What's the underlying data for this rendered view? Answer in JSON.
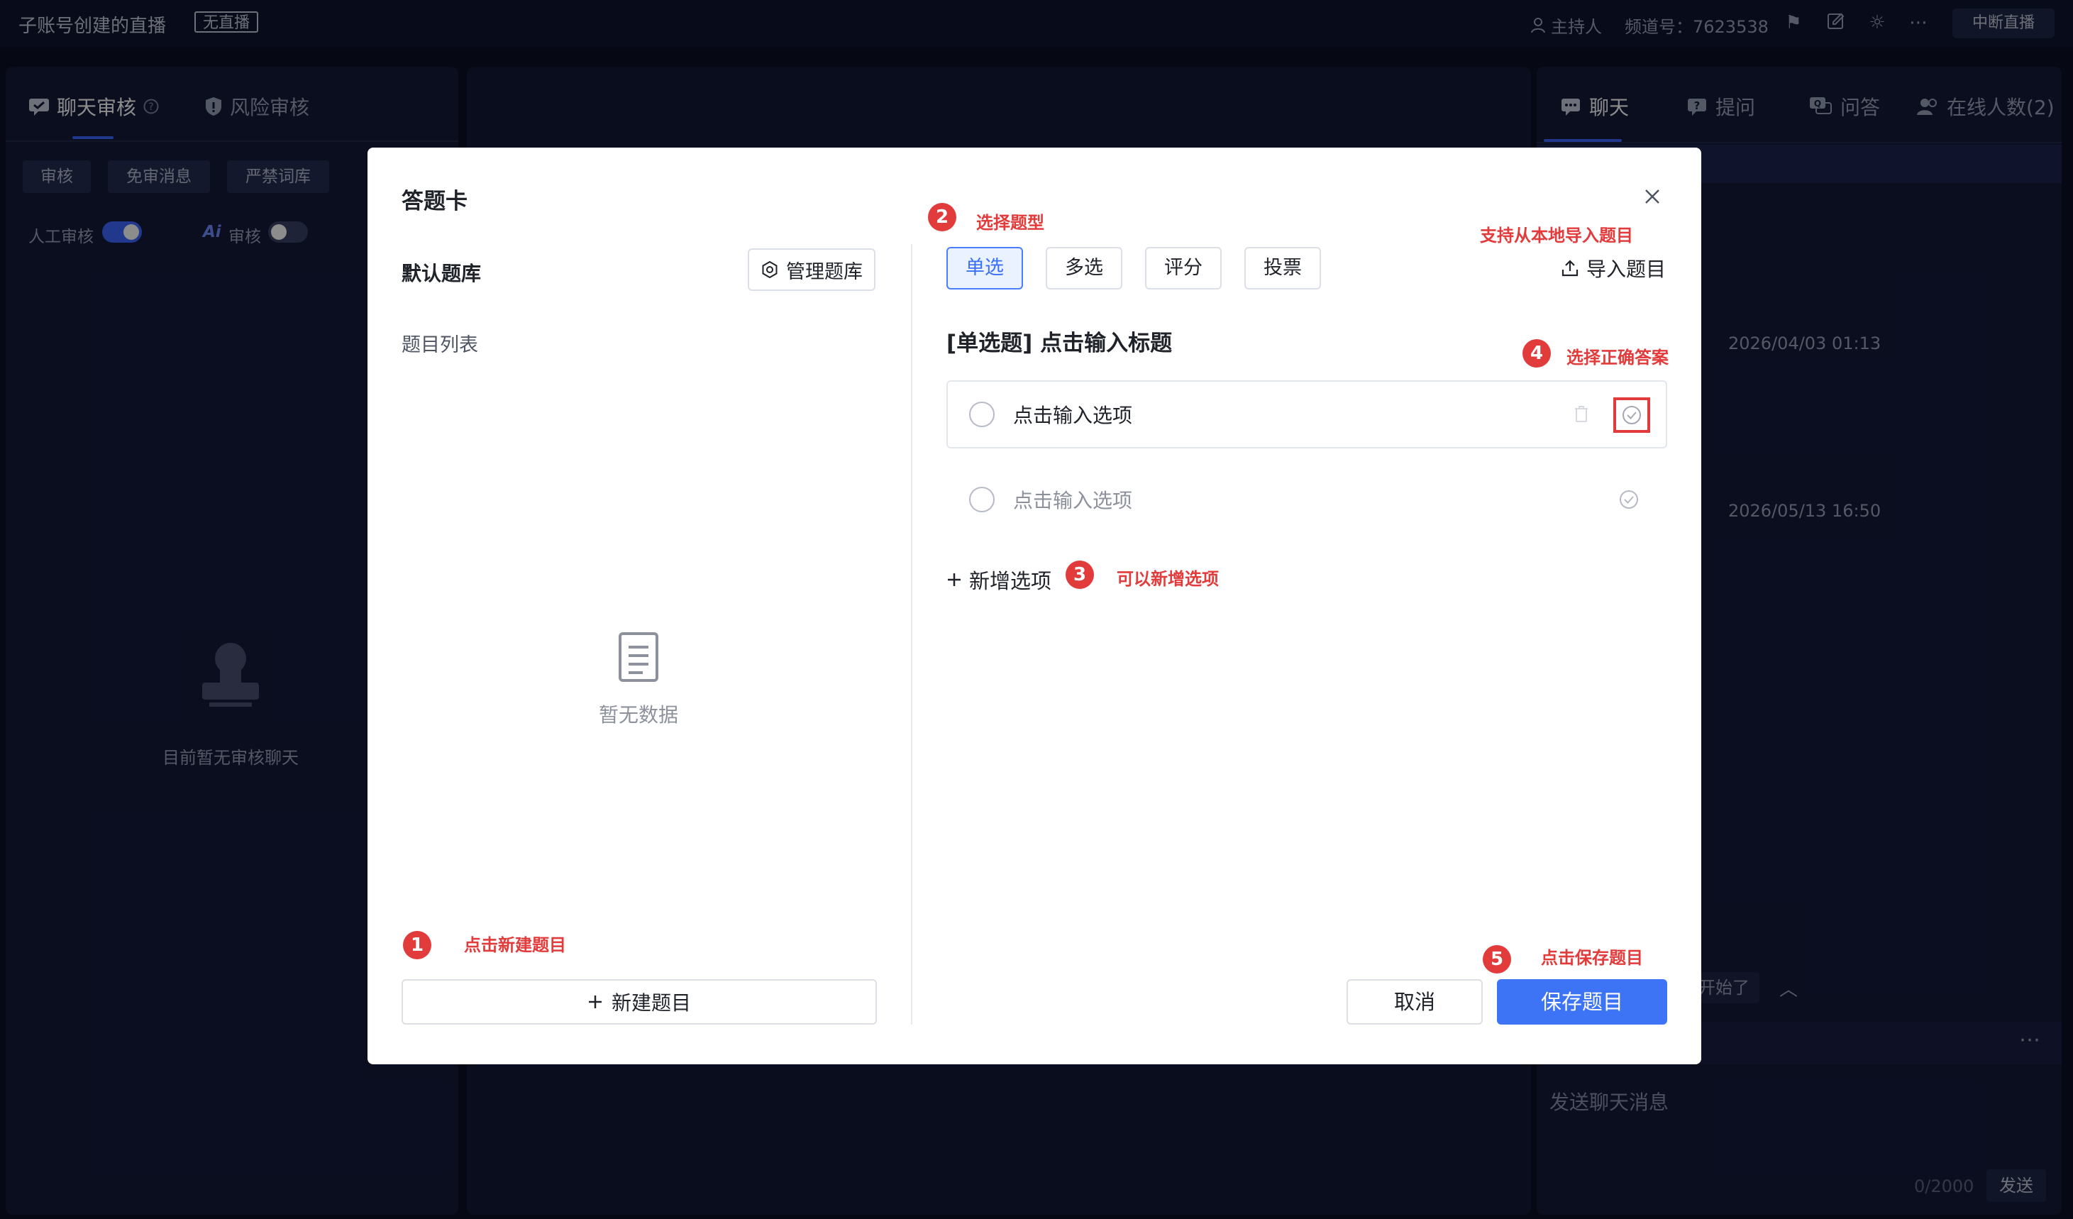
{
  "topbar": {
    "title": "子账号创建的直播",
    "live_status": "无直播",
    "host": "主持人",
    "channel": "频道号：7623538",
    "stop_button": "中断直播"
  },
  "left_panel": {
    "tab_chat_review": "聊天审核",
    "tab_risk_review": "风险审核",
    "chips": [
      "审核",
      "免审消息",
      "严禁词库"
    ],
    "manual_review": "人工审核",
    "ai_review": "审核",
    "manual_review_on": true,
    "ai_review_on": false,
    "empty_text": "目前暂无审核聊天"
  },
  "right_panel": {
    "tabs": [
      {
        "label": "聊天",
        "icon": "chat-icon"
      },
      {
        "label": "提问",
        "icon": "question-icon"
      },
      {
        "label": "问答",
        "icon": "qa-icon"
      },
      {
        "label": "在线人数(2)",
        "icon": "users-icon"
      }
    ],
    "times": [
      "2026/04/03 01:13",
      "2026/05/13 16:50"
    ],
    "started_text": "开始了",
    "input_placeholder": "发送聊天消息",
    "char_count": "0/2000",
    "send_button": "发送"
  },
  "modal": {
    "title": "答题卡",
    "bank_title": "默认题库",
    "manage_button": "管理题库",
    "list_title": "题目列表",
    "no_data": "暂无数据",
    "new_question_button": "新建题目",
    "types": [
      "单选",
      "多选",
      "评分",
      "投票"
    ],
    "active_type": "单选",
    "import_button": "导入题目",
    "question_title": "[单选题] 点击输入标题",
    "options": [
      {
        "placeholder": "点击输入选项",
        "hover": true
      },
      {
        "placeholder": "点击输入选项",
        "hover": false
      }
    ],
    "add_option": "新增选项",
    "cancel_button": "取消",
    "save_button": "保存题目"
  },
  "annotations": {
    "step1_num": "1",
    "step1": "点击新建题目",
    "step2_num": "2",
    "step2": "选择题型",
    "import_hint": "支持从本地导入题目",
    "step3_num": "3",
    "step3": "可以新增选项",
    "step4_num": "4",
    "step4": "选择正确答案",
    "step5_num": "5",
    "step5": "点击保存题目"
  },
  "colors": {
    "accent": "#3d73f5",
    "annotation": "#e23b3b",
    "background": "#0b0f24"
  }
}
